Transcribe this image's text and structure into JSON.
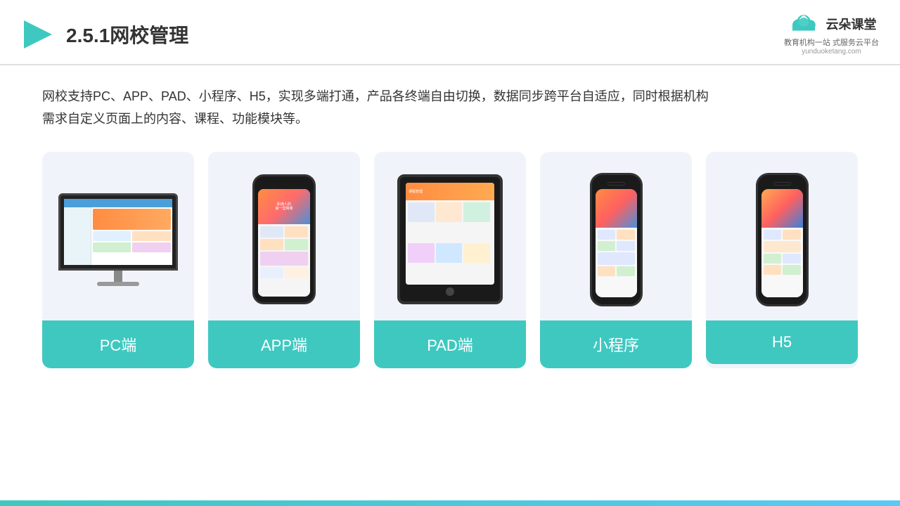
{
  "header": {
    "title": "2.5.1网校管理",
    "logo_name": "云朵课堂",
    "logo_url": "yunduoketang.com",
    "logo_tagline": "教育机构一站\n式服务云平台"
  },
  "description": "网校支持PC、APP、PAD、小程序、H5，实现多端打通，产品各终端自由切换，数据同步跨平台自适应，同时根据机构\n需求自定义页面上的内容、课程、功能模块等。",
  "cards": [
    {
      "id": "pc",
      "label": "PC端"
    },
    {
      "id": "app",
      "label": "APP端"
    },
    {
      "id": "pad",
      "label": "PAD端"
    },
    {
      "id": "miniprogram",
      "label": "小程序"
    },
    {
      "id": "h5",
      "label": "H5"
    }
  ],
  "colors": {
    "teal": "#3ec8c0",
    "accent_blue": "#4a90d9",
    "orange": "#ff8c42",
    "card_bg": "#eef2f8"
  }
}
